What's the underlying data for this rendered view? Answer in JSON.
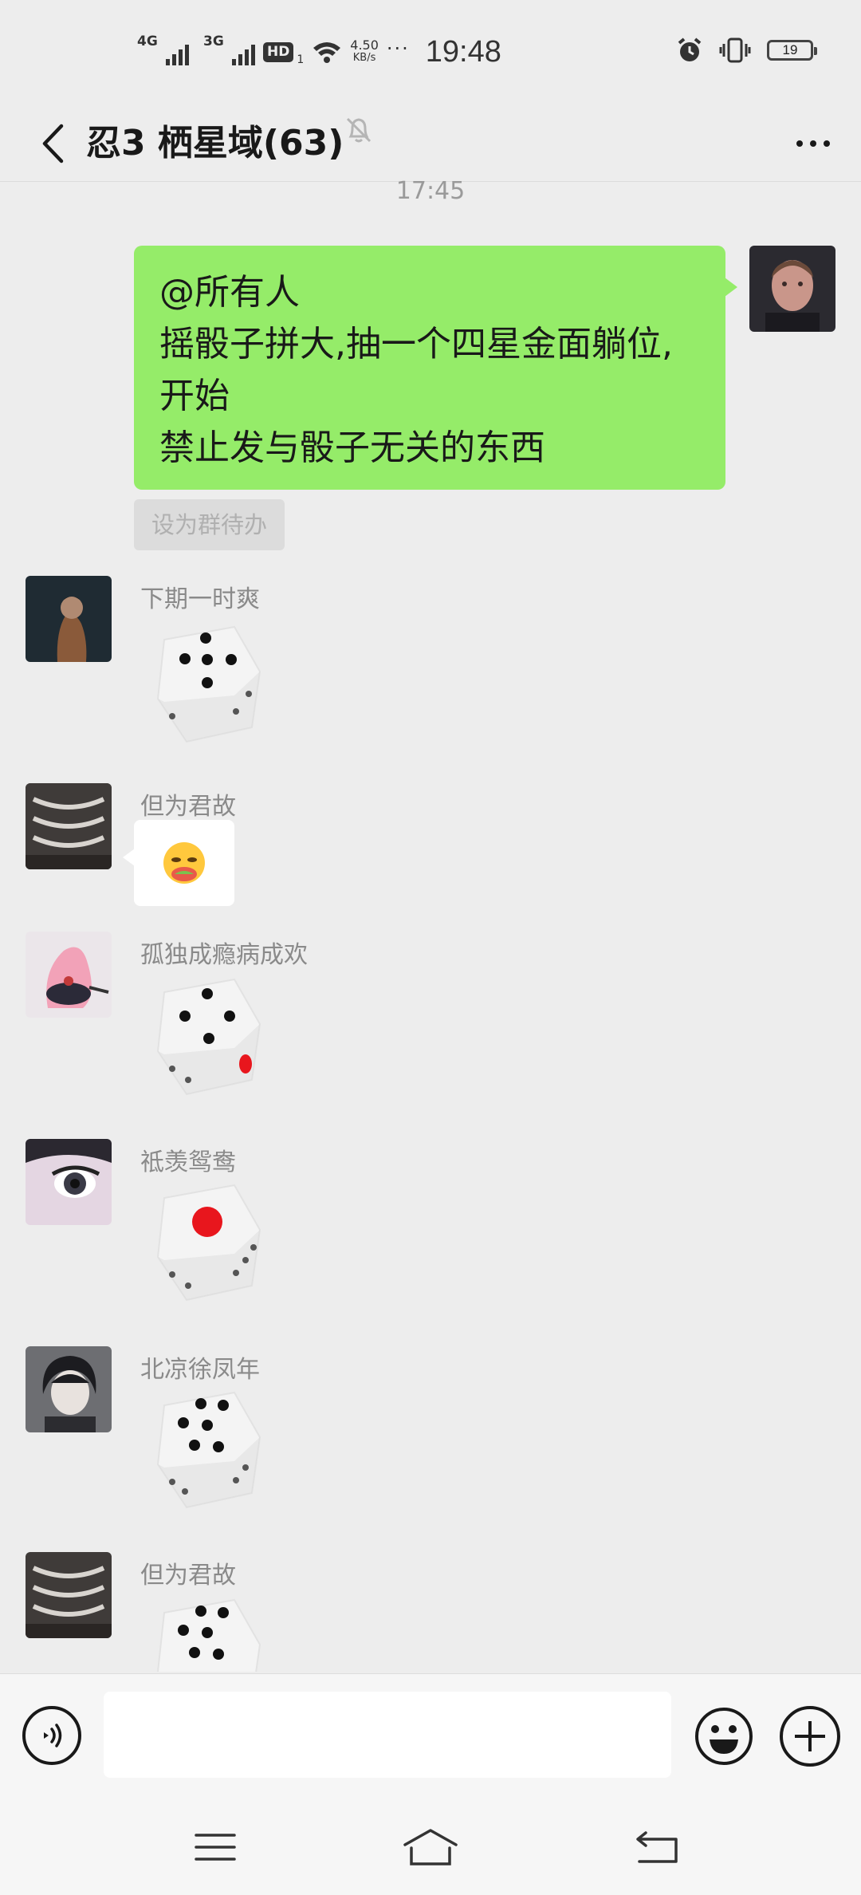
{
  "status_bar": {
    "signal_1": "4G",
    "signal_2": "3G",
    "hd": "HD",
    "hd_sub": "1",
    "speed_value": "4.50",
    "speed_unit": "KB/s",
    "more": "···",
    "time": "19:48",
    "battery": "19"
  },
  "header": {
    "back_icon": "chevron-left-icon",
    "title": "忍3 栖星域(63)",
    "mute_icon": "bell-off-icon",
    "more_icon": "more-dots-icon"
  },
  "chat": {
    "timestamp": "17:45",
    "my_message": {
      "lines": [
        "@所有人",
        "摇骰子拼大,抽一个四星金面躺位,",
        "开始",
        "禁止发与骰子无关的东西"
      ]
    },
    "todo_label": "设为群待办",
    "messages": [
      {
        "sender": "下期一时爽",
        "type": "dice",
        "value": 5
      },
      {
        "sender": "但为君故",
        "type": "emoji",
        "emoji_icon": "cheeky-face-emoji"
      },
      {
        "sender": "孤独成瘾病成欢",
        "type": "dice",
        "value": 4
      },
      {
        "sender": "祗羡鸳鸯",
        "type": "dice",
        "value": 1
      },
      {
        "sender": "北凉徐凤年",
        "type": "dice",
        "value": 6
      },
      {
        "sender": "但为君故",
        "type": "dice",
        "value": 6
      }
    ]
  },
  "input_bar": {
    "voice_icon": "voice-icon",
    "text_value": "",
    "emoji_icon": "smiley-icon",
    "plus_icon": "plus-circle-icon"
  },
  "nav_bar": {
    "menu_icon": "menu-icon",
    "home_icon": "home-icon",
    "back_icon": "back-arrow-icon"
  },
  "colors": {
    "background": "#ededed",
    "my_bubble": "#95ec69",
    "dice_red_pip": "#e8161d"
  }
}
